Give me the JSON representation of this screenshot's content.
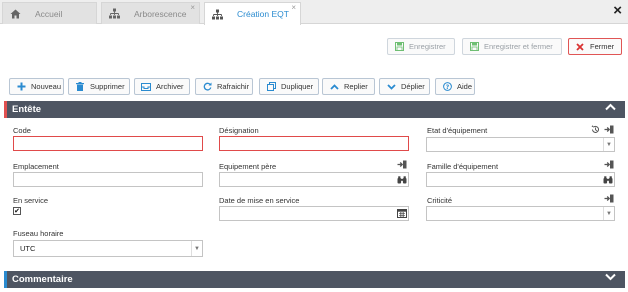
{
  "tabs": [
    {
      "label": "Accueil",
      "icon": "home-icon"
    },
    {
      "label": "Arborescence",
      "icon": "hierarchy-icon",
      "closable": true
    },
    {
      "label": "Création EQT",
      "icon": "hierarchy-icon",
      "closable": true,
      "active": true
    }
  ],
  "window": {
    "close_label": "×",
    "tab_close_label": "×"
  },
  "top_actions": {
    "save": "Enregistrer",
    "save_close": "Enregistrer et fermer",
    "close": "Fermer"
  },
  "toolbar": {
    "new": "Nouveau",
    "delete": "Supprimer",
    "archive": "Archiver",
    "refresh": "Rafraichir",
    "duplicate": "Dupliquer",
    "collapse": "Replier",
    "expand": "Déplier",
    "help": "Aide"
  },
  "sections": {
    "header": "Entête",
    "comment": "Commentaire"
  },
  "form": {
    "code": {
      "label": "Code",
      "value": ""
    },
    "designation": {
      "label": "Désignation",
      "value": ""
    },
    "etat": {
      "label": "Etat d'équipement",
      "value": ""
    },
    "emplacement": {
      "label": "Emplacement",
      "value": ""
    },
    "equipement_pere": {
      "label": "Equipement père",
      "value": ""
    },
    "famille": {
      "label": "Famille d'équipement",
      "value": ""
    },
    "en_service": {
      "label": "En service",
      "checked": true,
      "check_mark": "✔"
    },
    "date_service": {
      "label": "Date de mise en service",
      "value": ""
    },
    "criticite": {
      "label": "Criticité",
      "value": ""
    },
    "fuseau": {
      "label": "Fuseau horaire",
      "value": "UTC"
    }
  },
  "colors": {
    "accent_blue": "#2a8bd0",
    "required_border": "#e04a4a",
    "save_green": "#4caf50",
    "section_bg": "#4e5562"
  }
}
